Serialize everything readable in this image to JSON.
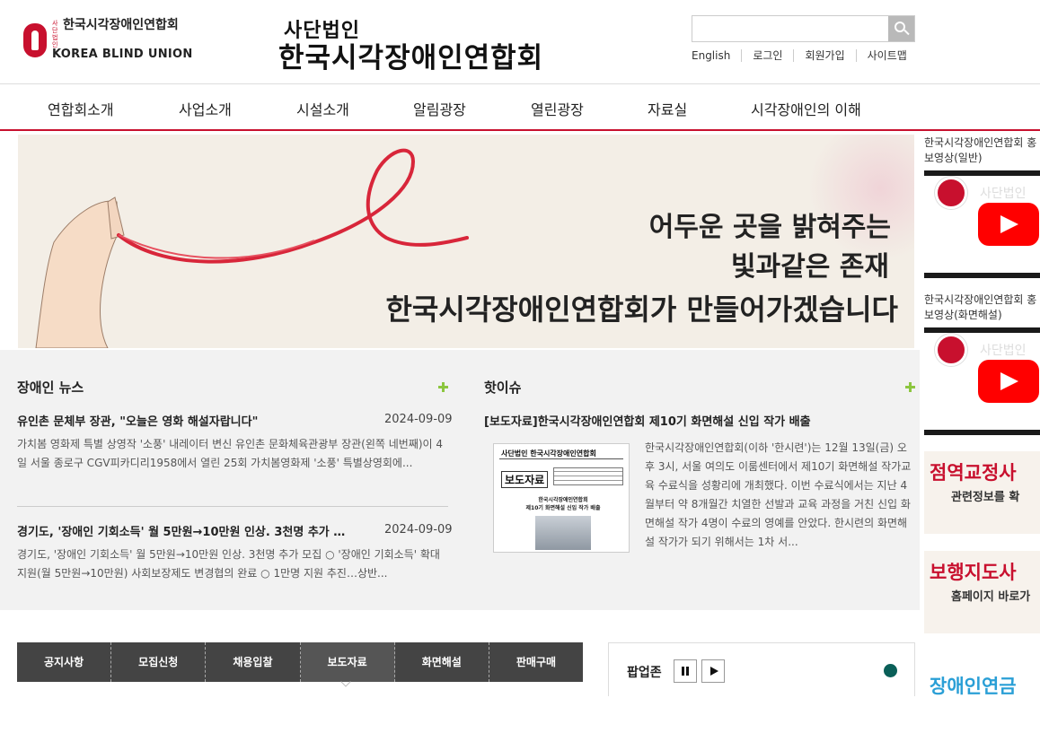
{
  "header": {
    "logo_small_sub": "사단법인",
    "logo_small_kr": "한국시각장애인연합회",
    "logo_small_en": "KOREA BLIND UNION",
    "center_logo_sub": "사단법인",
    "center_logo_main": "한국시각장애인연합회",
    "search_placeholder": "",
    "util_links": [
      "English",
      "로그인",
      "회원가입",
      "사이트맵"
    ]
  },
  "nav": {
    "items": [
      "연합회소개",
      "사업소개",
      "시설소개",
      "알림광장",
      "열린광장",
      "자료실",
      "시각장애인의 이해"
    ]
  },
  "banner": {
    "line1": "어두운 곳을 밝혀주는",
    "line2": "빛과같은 존재",
    "line3": "한국시각장애인연합회가 만들어가겠습니다"
  },
  "sidebar": {
    "video1_label": "한국시각장애인연합회 홍보영상(일반)",
    "video2_label": "한국시각장애인연합회 홍보영상(화면해설)",
    "video_title": "사단법인",
    "banner1_title": "점역교정사",
    "banner1_sub": "관련정보를 확",
    "banner2_title": "보행지도사",
    "banner2_sub": "홈페이지 바로가",
    "banner3_title": "장애인연금"
  },
  "news": {
    "title": "장애인 뉴스",
    "items": [
      {
        "title": "유인촌 문체부 장관, \"오늘은 영화 해설자랍니다\"",
        "date": "2024-09-09",
        "body": "가치봄 영화제 특별 상영작 '소풍' 내레이터 변신  유인촌 문화체육관광부 장관(왼쪽 네번째)이 4일 서울 종로구 CGV피카디리1958에서 열린 25회 가치봄영화제 '소풍' 특별상영회에..."
      },
      {
        "title": "경기도, '장애인 기회소득' 월 5만원→10만원 인상. 3천명 추가 …",
        "date": "2024-09-09",
        "body": " 경기도, '장애인 기회소득' 월 5만원→10만원 인상. 3천명 추가 모집 ○ '장애인 기회소득' 확대 지원(월 5만원→10만원) 사회보장제도 변경협의 완료 ○ 1만명 지원 추진…상반..."
      }
    ]
  },
  "hot": {
    "title": "핫이슈",
    "headline": "[보도자료]한국시각장애인연합회 제10기 화면해설 신입 작가 배출",
    "body": "한국시각장애인연합회(이하 '한시련')는 12월 13일(금) 오후 3시, 서울 여의도 이룸센터에서 제10기 화면해설 작가교육 수료식을 성황리에 개최했다.   이번 수료식에서는 지난 4월부터 약 8개월간 치열한 선발과 교육 과정을 거친 신입 화면해설 작가 4명이 수료의 영예를 안았다. 한시련의 화면해설 작가가 되기 위해서는 1차 서...",
    "thumb_title": "사단법인  한국시각장애인연합회",
    "thumb_box": "보도자료",
    "thumb_caption_1": "한국시각장애인연합회",
    "thumb_caption_2": "제10기 화면해설 신입 작가 배출"
  },
  "board_tabs": [
    "공지사항",
    "모집신청",
    "채용입찰",
    "보도자료",
    "화면해설",
    "판매구매"
  ],
  "popup": {
    "title": "팝업존"
  }
}
